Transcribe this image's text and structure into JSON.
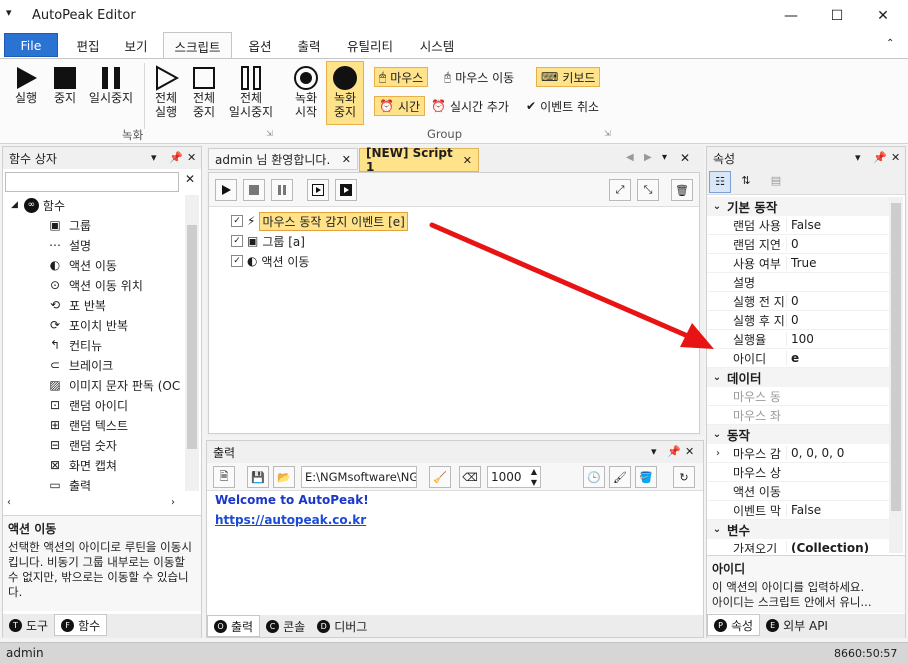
{
  "window": {
    "title": "AutoPeak Editor",
    "minimize": "—",
    "maximize": "☐",
    "close": "✕"
  },
  "ribbon_tabs": [
    "File",
    "편집",
    "보기",
    "스크립트",
    "옵션",
    "출력",
    "유틸리티",
    "시스템"
  ],
  "ribbon": {
    "recording_group": "녹화",
    "group_group": "Group",
    "run": "실행",
    "stop": "중지",
    "pause": "일시중지",
    "run_all_1": "전체",
    "run_all_2": "실행",
    "stop_all_1": "전체",
    "stop_all_2": "중지",
    "pause_all_1": "전체",
    "pause_all_2": "일시중지",
    "rec_start_1": "녹화",
    "rec_start_2": "시작",
    "rec_stop_1": "녹화",
    "rec_stop_2": "중지",
    "mouse": "마우스",
    "mouse_move": "마우스 이동",
    "keyboard": "키보드",
    "time": "시간",
    "add_realtime": "실시간 추가",
    "cancel_event": "이벤트 취소"
  },
  "left_panel": {
    "title": "함수 상자",
    "root": "함수",
    "items": [
      "그룹",
      "설명",
      "액션 이동",
      "액션 이동 위치",
      "포 반복",
      "포이치 반복",
      "컨티뉴",
      "브레이크",
      "이미지 문자 판독 (OC",
      "랜덤 아이디",
      "랜덤 텍스트",
      "랜덤 숫자",
      "화면 캡쳐",
      "출력"
    ],
    "desc_title": "액션 이동",
    "desc_text": "선택한 액션의 아이디로 루틴을 이동시킵니다. 비동기 그룹 내부로는 이동할 수 없지만, 밖으로는 이동할 수 있습니다.",
    "tabs": [
      {
        "key": "T",
        "label": "도구"
      },
      {
        "key": "F",
        "label": "함수"
      }
    ]
  },
  "doc_tabs": [
    "admin 님 환영합니다.",
    "[NEW] Script 1"
  ],
  "script_lines": [
    {
      "text": "마우스 동작 감지 이벤트 [e]",
      "checked": true
    },
    {
      "text": "그룹 [a]",
      "checked": true
    },
    {
      "text": "액션 이동",
      "checked": true
    }
  ],
  "output": {
    "title": "출력",
    "path": "E:\\NGMsoftware\\NG",
    "count": "1000",
    "line1": "Welcome to AutoPeak!",
    "line2": "https://autopeak.co.kr",
    "tabs": [
      {
        "key": "O",
        "label": "출력"
      },
      {
        "key": "C",
        "label": "콘솔"
      },
      {
        "key": "D",
        "label": "디버그"
      }
    ]
  },
  "properties": {
    "title": "속성",
    "categories": [
      {
        "name": "기본 동작",
        "rows": [
          {
            "k": "랜덤 사용",
            "v": "False"
          },
          {
            "k": "랜덤 지연",
            "v": "0"
          },
          {
            "k": "사용 여부",
            "v": "True"
          },
          {
            "k": "설명",
            "v": ""
          },
          {
            "k": "실행 전 지",
            "v": "0"
          },
          {
            "k": "실행 후 지",
            "v": "0"
          },
          {
            "k": "실행율",
            "v": "100"
          },
          {
            "k": "아이디",
            "v": "e"
          }
        ]
      },
      {
        "name": "데이터",
        "rows": [
          {
            "k": "마우스 동",
            "v": ""
          },
          {
            "k": "마우스 좌",
            "v": ""
          }
        ]
      },
      {
        "name": "동작",
        "rows": [
          {
            "k": "마우스 감",
            "v": "0, 0, 0, 0"
          },
          {
            "k": "마우스 상",
            "v": ""
          },
          {
            "k": "액션 이동",
            "v": ""
          },
          {
            "k": "이벤트 막",
            "v": "False"
          }
        ]
      },
      {
        "name": "변수",
        "rows": [
          {
            "k": "가져오기",
            "v": "(Collection)"
          }
        ]
      }
    ],
    "desc_title": "아이디",
    "desc_line1": "이 액션의 아이디를 입력하세요.",
    "desc_line2": "아이디는 스크립트 안에서 유니...",
    "tabs": [
      {
        "key": "P",
        "label": "속성"
      },
      {
        "key": "E",
        "label": "외부 API"
      }
    ]
  },
  "status": {
    "user": "admin",
    "time": "8660:50:57"
  },
  "colors": {
    "accent": "#2b73d2",
    "highlight": "#ffe38a",
    "arrow": "#e81414"
  }
}
